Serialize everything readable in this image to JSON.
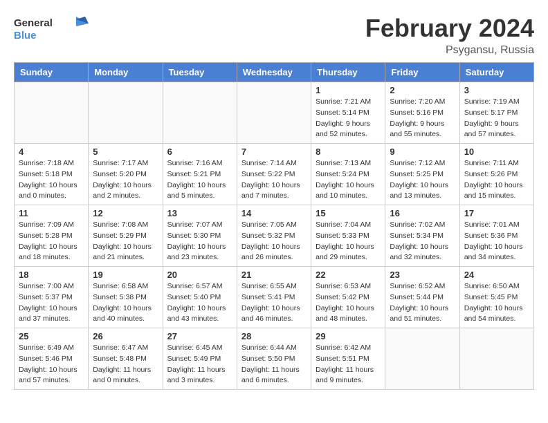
{
  "header": {
    "logo_general": "General",
    "logo_blue": "Blue",
    "title": "February 2024",
    "subtitle": "Psygansu, Russia"
  },
  "weekdays": [
    "Sunday",
    "Monday",
    "Tuesday",
    "Wednesday",
    "Thursday",
    "Friday",
    "Saturday"
  ],
  "weeks": [
    [
      {
        "day": "",
        "info": ""
      },
      {
        "day": "",
        "info": ""
      },
      {
        "day": "",
        "info": ""
      },
      {
        "day": "",
        "info": ""
      },
      {
        "day": "1",
        "info": "Sunrise: 7:21 AM\nSunset: 5:14 PM\nDaylight: 9 hours\nand 52 minutes."
      },
      {
        "day": "2",
        "info": "Sunrise: 7:20 AM\nSunset: 5:16 PM\nDaylight: 9 hours\nand 55 minutes."
      },
      {
        "day": "3",
        "info": "Sunrise: 7:19 AM\nSunset: 5:17 PM\nDaylight: 9 hours\nand 57 minutes."
      }
    ],
    [
      {
        "day": "4",
        "info": "Sunrise: 7:18 AM\nSunset: 5:18 PM\nDaylight: 10 hours\nand 0 minutes."
      },
      {
        "day": "5",
        "info": "Sunrise: 7:17 AM\nSunset: 5:20 PM\nDaylight: 10 hours\nand 2 minutes."
      },
      {
        "day": "6",
        "info": "Sunrise: 7:16 AM\nSunset: 5:21 PM\nDaylight: 10 hours\nand 5 minutes."
      },
      {
        "day": "7",
        "info": "Sunrise: 7:14 AM\nSunset: 5:22 PM\nDaylight: 10 hours\nand 7 minutes."
      },
      {
        "day": "8",
        "info": "Sunrise: 7:13 AM\nSunset: 5:24 PM\nDaylight: 10 hours\nand 10 minutes."
      },
      {
        "day": "9",
        "info": "Sunrise: 7:12 AM\nSunset: 5:25 PM\nDaylight: 10 hours\nand 13 minutes."
      },
      {
        "day": "10",
        "info": "Sunrise: 7:11 AM\nSunset: 5:26 PM\nDaylight: 10 hours\nand 15 minutes."
      }
    ],
    [
      {
        "day": "11",
        "info": "Sunrise: 7:09 AM\nSunset: 5:28 PM\nDaylight: 10 hours\nand 18 minutes."
      },
      {
        "day": "12",
        "info": "Sunrise: 7:08 AM\nSunset: 5:29 PM\nDaylight: 10 hours\nand 21 minutes."
      },
      {
        "day": "13",
        "info": "Sunrise: 7:07 AM\nSunset: 5:30 PM\nDaylight: 10 hours\nand 23 minutes."
      },
      {
        "day": "14",
        "info": "Sunrise: 7:05 AM\nSunset: 5:32 PM\nDaylight: 10 hours\nand 26 minutes."
      },
      {
        "day": "15",
        "info": "Sunrise: 7:04 AM\nSunset: 5:33 PM\nDaylight: 10 hours\nand 29 minutes."
      },
      {
        "day": "16",
        "info": "Sunrise: 7:02 AM\nSunset: 5:34 PM\nDaylight: 10 hours\nand 32 minutes."
      },
      {
        "day": "17",
        "info": "Sunrise: 7:01 AM\nSunset: 5:36 PM\nDaylight: 10 hours\nand 34 minutes."
      }
    ],
    [
      {
        "day": "18",
        "info": "Sunrise: 7:00 AM\nSunset: 5:37 PM\nDaylight: 10 hours\nand 37 minutes."
      },
      {
        "day": "19",
        "info": "Sunrise: 6:58 AM\nSunset: 5:38 PM\nDaylight: 10 hours\nand 40 minutes."
      },
      {
        "day": "20",
        "info": "Sunrise: 6:57 AM\nSunset: 5:40 PM\nDaylight: 10 hours\nand 43 minutes."
      },
      {
        "day": "21",
        "info": "Sunrise: 6:55 AM\nSunset: 5:41 PM\nDaylight: 10 hours\nand 46 minutes."
      },
      {
        "day": "22",
        "info": "Sunrise: 6:53 AM\nSunset: 5:42 PM\nDaylight: 10 hours\nand 48 minutes."
      },
      {
        "day": "23",
        "info": "Sunrise: 6:52 AM\nSunset: 5:44 PM\nDaylight: 10 hours\nand 51 minutes."
      },
      {
        "day": "24",
        "info": "Sunrise: 6:50 AM\nSunset: 5:45 PM\nDaylight: 10 hours\nand 54 minutes."
      }
    ],
    [
      {
        "day": "25",
        "info": "Sunrise: 6:49 AM\nSunset: 5:46 PM\nDaylight: 10 hours\nand 57 minutes."
      },
      {
        "day": "26",
        "info": "Sunrise: 6:47 AM\nSunset: 5:48 PM\nDaylight: 11 hours\nand 0 minutes."
      },
      {
        "day": "27",
        "info": "Sunrise: 6:45 AM\nSunset: 5:49 PM\nDaylight: 11 hours\nand 3 minutes."
      },
      {
        "day": "28",
        "info": "Sunrise: 6:44 AM\nSunset: 5:50 PM\nDaylight: 11 hours\nand 6 minutes."
      },
      {
        "day": "29",
        "info": "Sunrise: 6:42 AM\nSunset: 5:51 PM\nDaylight: 11 hours\nand 9 minutes."
      },
      {
        "day": "",
        "info": ""
      },
      {
        "day": "",
        "info": ""
      }
    ]
  ]
}
